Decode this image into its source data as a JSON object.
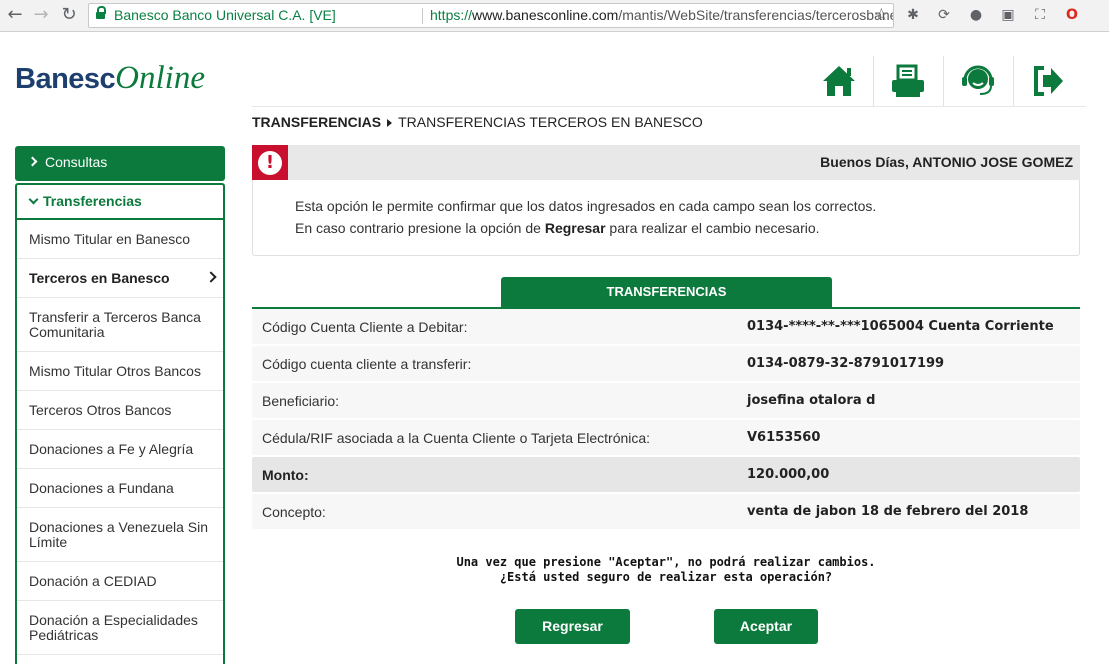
{
  "browser": {
    "site_identity": "Banesco Banco Universal C.A. [VE]",
    "url_scheme": "https://",
    "url_host": "www.banesconline.com",
    "url_path": "/mantis/WebSite/transferencias/tercerosbanesco.aspx"
  },
  "logo": {
    "part1": "Banesc",
    "part2": "Online"
  },
  "header_icons": [
    "home-icon",
    "print-icon",
    "support-headset-icon",
    "logout-icon"
  ],
  "breadcrumb": {
    "section": "TRANSFERENCIAS",
    "page": "TRANSFERENCIAS TERCEROS EN BANESCO"
  },
  "sidebar": {
    "consultas": "Consultas",
    "transferencias": "Transferencias",
    "items": [
      {
        "label": "Mismo Titular en Banesco"
      },
      {
        "label": "Terceros en Banesco"
      },
      {
        "label": "Transferir a Terceros Banca Comunitaria"
      },
      {
        "label": "Mismo Titular Otros Bancos"
      },
      {
        "label": "Terceros Otros Bancos"
      },
      {
        "label": "Donaciones a Fe y Alegría"
      },
      {
        "label": "Donaciones a Fundana"
      },
      {
        "label": "Donaciones a Venezuela Sin Límite"
      },
      {
        "label": "Donación a CEDIAD"
      },
      {
        "label": "Donación a Especialidades Pediátricas"
      }
    ]
  },
  "info": {
    "greeting": "Buenos Días, ANTONIO JOSE GOMEZ",
    "line1": "Esta opción le permite confirmar que los datos ingresados en cada campo sean los correctos.",
    "line2_pre": "En caso contrario presione la opción de",
    "line2_bold": "Regresar",
    "line2_post": "para realizar el cambio necesario."
  },
  "table": {
    "title": "TRANSFERENCIAS",
    "rows": [
      {
        "label": "Código Cuenta Cliente a Debitar:",
        "value": "0134-****-**-***1065004 Cuenta Corriente"
      },
      {
        "label": "Código cuenta cliente a transferir:",
        "value": "0134-0879-32-8791017199"
      },
      {
        "label": "Beneficiario:",
        "value": "josefina otalora d"
      },
      {
        "label": "Cédula/RIF asociada a la Cuenta Cliente o Tarjeta Electrónica:",
        "value": "V6153560"
      },
      {
        "label": "Monto:",
        "value": "120.000,00"
      },
      {
        "label": "Concepto:",
        "value": "venta de jabon 18 de febrero del 2018"
      }
    ]
  },
  "warning": {
    "line1": "Una vez que presione \"Aceptar\", no podrá realizar cambios.",
    "line2": "¿Está usted seguro de realizar esta operación?"
  },
  "buttons": {
    "back": "Regresar",
    "accept": "Aceptar"
  }
}
